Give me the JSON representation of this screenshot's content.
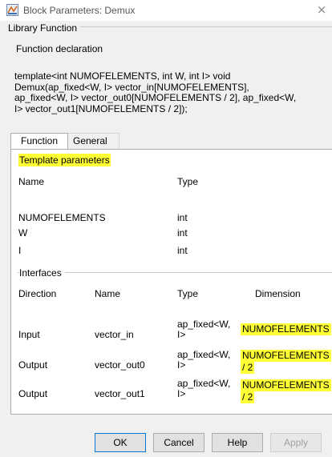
{
  "window": {
    "title": "Block Parameters: Demux",
    "close_glyph": "×"
  },
  "library": {
    "group_label": "Library Function",
    "decl_label": "Function declaration",
    "declaration": "template<int NUMOFELEMENTS, int W, int I> void\nDemux(ap_fixed<W, I> vector_in[NUMOFELEMENTS],\nap_fixed<W, I> vector_out0[NUMOFELEMENTS / 2], ap_fixed<W,\nI> vector_out1[NUMOFELEMENTS / 2]);"
  },
  "tabs": {
    "function": "Function",
    "general": "General"
  },
  "template_params": {
    "label": "Template parameters",
    "headers": {
      "name": "Name",
      "type": "Type"
    },
    "rows": [
      {
        "name": "NUMOFELEMENTS",
        "type": "int"
      },
      {
        "name": "W",
        "type": "int"
      },
      {
        "name": "I",
        "type": "int"
      }
    ]
  },
  "interfaces": {
    "label": "Interfaces",
    "headers": {
      "direction": "Direction",
      "name": "Name",
      "type": "Type",
      "dimension": "Dimension"
    },
    "rows": [
      {
        "direction": "Input",
        "name": "vector_in",
        "type_l1": "ap_fixed<W,",
        "type_l2": "I>",
        "dim_l1": "NUMOFELEMENTS",
        "dim_l2": ""
      },
      {
        "direction": "Output",
        "name": "vector_out0",
        "type_l1": "ap_fixed<W,",
        "type_l2": "I>",
        "dim_l1": "NUMOFELEMENTS",
        "dim_l2": "/ 2"
      },
      {
        "direction": "Output",
        "name": "vector_out1",
        "type_l1": "ap_fixed<W,",
        "type_l2": "I>",
        "dim_l1": "NUMOFELEMENTS",
        "dim_l2": "/ 2"
      }
    ]
  },
  "buttons": {
    "ok": "OK",
    "cancel": "Cancel",
    "help": "Help",
    "apply": "Apply"
  },
  "colors": {
    "highlight": "#ffff35",
    "accent": "#0078d7"
  },
  "icons": {
    "app": "simulink-block-icon",
    "close": "close-icon"
  }
}
